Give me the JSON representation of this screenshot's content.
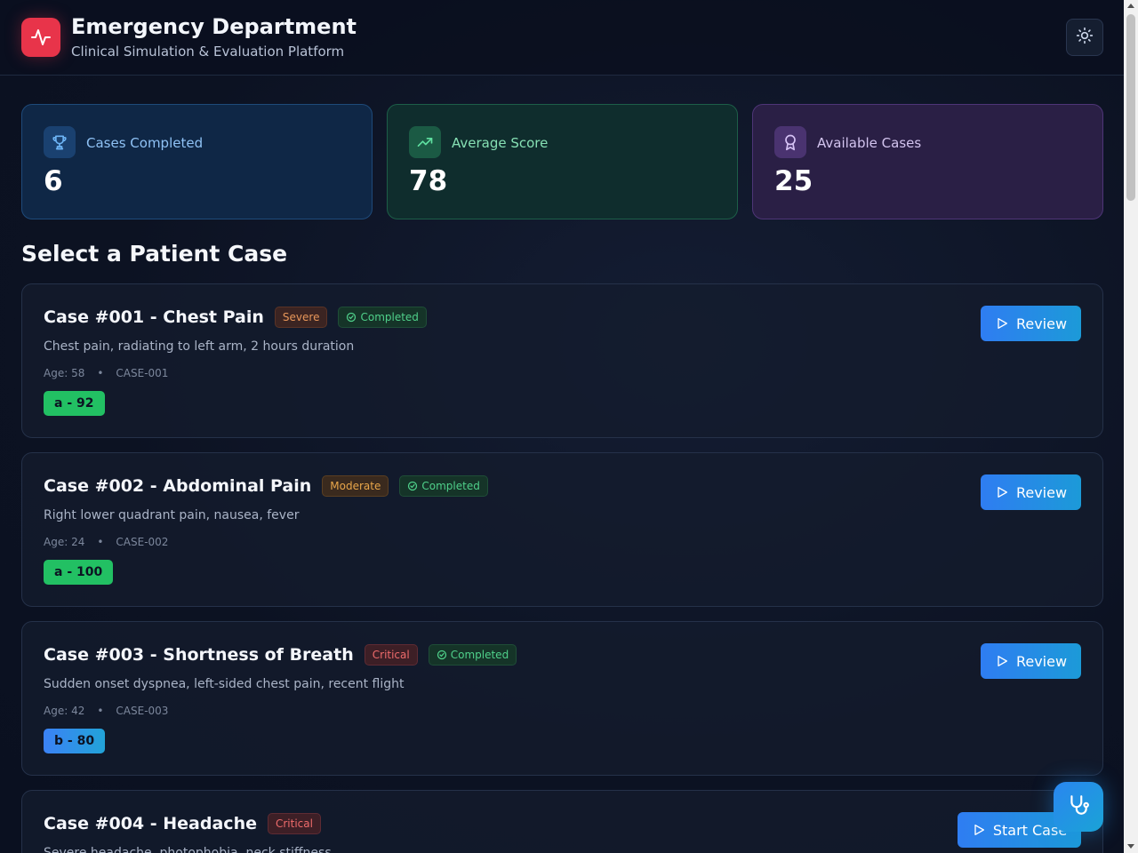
{
  "header": {
    "title": "Emergency Department",
    "subtitle": "Clinical Simulation & Evaluation Platform",
    "logo_icon": "heart-pulse-icon",
    "theme_icon": "sun-icon"
  },
  "stats": [
    {
      "label": "Cases Completed",
      "value": "6",
      "icon": "trophy-icon",
      "color": "#1a4170"
    },
    {
      "label": "Average Score",
      "value": "78",
      "icon": "trending-up-icon",
      "color": "#1b5a44"
    },
    {
      "label": "Available Cases",
      "value": "25",
      "icon": "award-icon",
      "color": "#4a3370"
    }
  ],
  "section_title": "Select a Patient Case",
  "cases": [
    {
      "title": "Case #001 - Chest Pain",
      "severity": "Severe",
      "status": "Completed",
      "description": "Chest pain, radiating to left arm, 2 hours duration",
      "age": "Age: 58",
      "separator": "•",
      "case_id": "CASE-001",
      "grade": "a - 92",
      "action": "Review"
    },
    {
      "title": "Case #002 - Abdominal Pain",
      "severity": "Moderate",
      "status": "Completed",
      "description": "Right lower quadrant pain, nausea, fever",
      "age": "Age: 24",
      "separator": "•",
      "case_id": "CASE-002",
      "grade": "a - 100",
      "action": "Review"
    },
    {
      "title": "Case #003 - Shortness of Breath",
      "severity": "Critical",
      "status": "Completed",
      "description": "Sudden onset dyspnea, left-sided chest pain, recent flight",
      "age": "Age: 42",
      "separator": "•",
      "case_id": "CASE-003",
      "grade": "b - 80",
      "action": "Review"
    },
    {
      "title": "Case #004 - Headache",
      "severity": "Critical",
      "description": "Severe headache, photophobia, neck stiffness",
      "action": "Start Case"
    }
  ],
  "fab_icon": "stethoscope-icon"
}
